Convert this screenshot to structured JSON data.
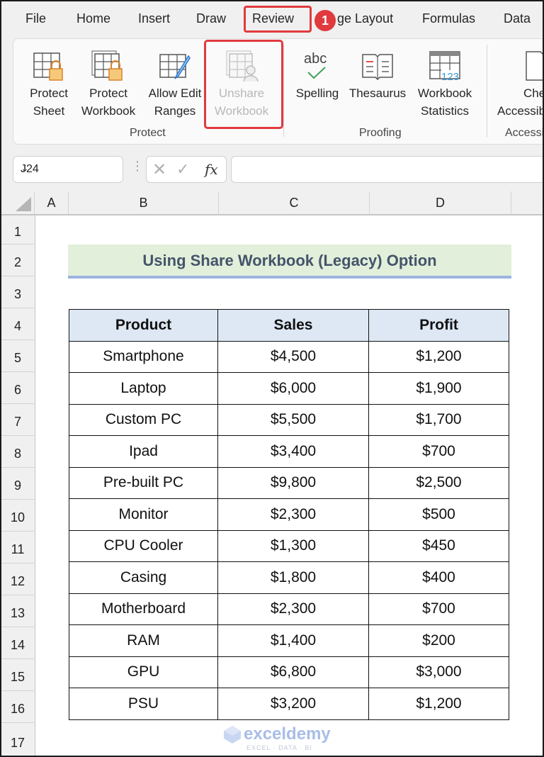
{
  "menu_tabs": [
    "File",
    "Home",
    "Insert",
    "Draw",
    "Review",
    "ge Layout",
    "Formulas",
    "Data"
  ],
  "active_tab": "Review",
  "step_badge": "1",
  "ribbon": {
    "groups": [
      {
        "name": "Protect",
        "buttons": [
          {
            "line1": "Protect",
            "line2": "Sheet",
            "icon": "protect-sheet-icon",
            "enabled": true
          },
          {
            "line1": "Protect",
            "line2": "Workbook",
            "icon": "protect-workbook-icon",
            "enabled": true
          },
          {
            "line1": "Allow Edit",
            "line2": "Ranges",
            "icon": "allow-edit-ranges-icon",
            "enabled": true
          },
          {
            "line1": "Unshare",
            "line2": "Workbook",
            "icon": "unshare-workbook-icon",
            "enabled": false
          }
        ]
      },
      {
        "name": "Proofing",
        "buttons": [
          {
            "line1": "Spelling",
            "line2": "",
            "icon": "spelling-icon",
            "enabled": true
          },
          {
            "line1": "Thesaurus",
            "line2": "",
            "icon": "thesaurus-icon",
            "enabled": true
          },
          {
            "line1": "Workbook",
            "line2": "Statistics",
            "icon": "workbook-statistics-icon",
            "enabled": true
          }
        ]
      },
      {
        "name": "Accessi",
        "buttons": [
          {
            "line1": "Che",
            "line2": "Accessib",
            "icon": "check-accessibility-icon",
            "enabled": true
          }
        ]
      }
    ]
  },
  "formula_bar": {
    "name_box": "J24",
    "formula": ""
  },
  "columns": [
    "A",
    "B",
    "C",
    "D"
  ],
  "rows": [
    "1",
    "2",
    "3",
    "4",
    "5",
    "6",
    "7",
    "8",
    "9",
    "10",
    "11",
    "12",
    "13",
    "14",
    "15",
    "16",
    "17"
  ],
  "sheet": {
    "title": "Using Share Workbook (Legacy) Option",
    "headers": [
      "Product",
      "Sales",
      "Profit"
    ],
    "records": [
      [
        "Smartphone",
        "$4,500",
        "$1,200"
      ],
      [
        "Laptop",
        "$6,000",
        "$1,900"
      ],
      [
        "Custom PC",
        "$5,500",
        "$1,700"
      ],
      [
        "Ipad",
        "$3,400",
        "$700"
      ],
      [
        "Pre-built PC",
        "$9,800",
        "$2,500"
      ],
      [
        "Monitor",
        "$2,300",
        "$500"
      ],
      [
        "CPU Cooler",
        "$1,300",
        "$450"
      ],
      [
        "Casing",
        "$1,800",
        "$400"
      ],
      [
        "Motherboard",
        "$2,300",
        "$700"
      ],
      [
        "RAM",
        "$1,400",
        "$200"
      ],
      [
        "GPU",
        "$6,800",
        "$3,000"
      ],
      [
        "PSU",
        "$3,200",
        "$1,200"
      ]
    ]
  },
  "watermark": {
    "name": "exceldemy",
    "tagline": "EXCEL · DATA · BI"
  },
  "colors": {
    "highlight": "#e03a3e",
    "title_fill": "#e2efda",
    "header_fill": "#dde8f4"
  }
}
